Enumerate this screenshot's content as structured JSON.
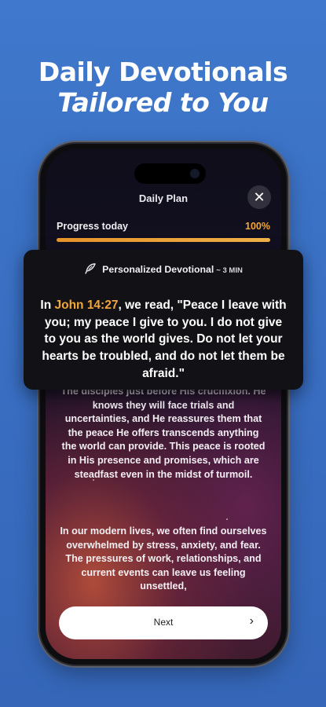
{
  "headline": {
    "line1": "Daily Devotionals",
    "line2": "Tailored to You"
  },
  "app": {
    "title": "Daily Plan",
    "close_icon": "close-icon",
    "progress": {
      "label": "Progress today",
      "value_text": "100%",
      "value": 1.0,
      "accent": "#f2a63a"
    },
    "body": {
      "paragraph1": "The disciples just before His crucifixion. He knows they will face trials and uncertainties, and He reassures them that the peace He offers transcends anything the world can provide. This peace is rooted in His presence and promises, which are steadfast even in the midst of turmoil.",
      "paragraph2": "In our modern lives, we often find ourselves overwhelmed by stress, anxiety, and fear. The pressures of work, relationships, and current events can leave us feeling unsettled,"
    },
    "next_button": {
      "label": "Next",
      "icon": "chevron-right-icon"
    }
  },
  "card": {
    "icon": "feather-icon",
    "title": "Personalized Devotional",
    "duration": "~ 3 MIN",
    "quote_prefix": "In ",
    "quote_reference": "John 14:27",
    "quote_text": ", we read, \"Peace I leave with you; my peace I give to you. I do not give to you as the world gives. Do not let your hearts be troubled, and do not let them be afraid.\""
  }
}
